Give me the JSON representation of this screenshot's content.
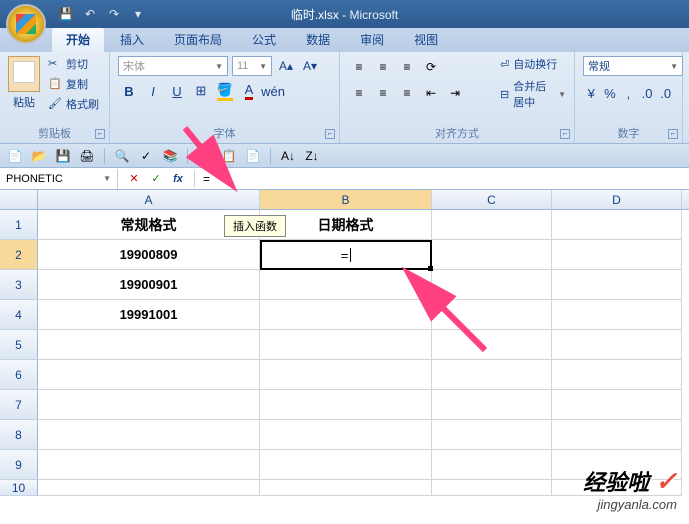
{
  "title": {
    "file": "临时.xlsx",
    "app": "Microsoft"
  },
  "tabs": {
    "home": "开始",
    "insert": "插入",
    "layout": "页面布局",
    "formula": "公式",
    "data": "数据",
    "review": "审阅",
    "view": "视图"
  },
  "clipboard": {
    "cut": "剪切",
    "copy": "复制",
    "format": "格式刷",
    "paste": "粘贴",
    "label": "剪贴板"
  },
  "font": {
    "name": "宋体",
    "size": "11",
    "label": "字体"
  },
  "align": {
    "wrap": "自动换行",
    "merge": "合并后居中",
    "label": "对齐方式"
  },
  "number": {
    "format": "常规",
    "label": "数字"
  },
  "nameBox": "PHONETIC",
  "formulaValue": "=",
  "tooltip": "插入函数",
  "columns": [
    "A",
    "B",
    "C",
    "D"
  ],
  "rowNums": [
    "1",
    "2",
    "3",
    "4",
    "5",
    "6",
    "7",
    "8",
    "9",
    "10"
  ],
  "cells": {
    "a1": "常规格式",
    "b1": "日期格式",
    "a2": "19900809",
    "b2": "=",
    "a3": "19900901",
    "a4": "19991001"
  },
  "chart_data": {
    "type": "table",
    "title": "",
    "columns": [
      "常规格式",
      "日期格式"
    ],
    "rows": [
      [
        "19900809",
        "="
      ],
      [
        "19900901",
        ""
      ],
      [
        "19991001",
        ""
      ]
    ]
  },
  "watermark": {
    "top": "经验啦",
    "bot": "jingyanla.com"
  }
}
